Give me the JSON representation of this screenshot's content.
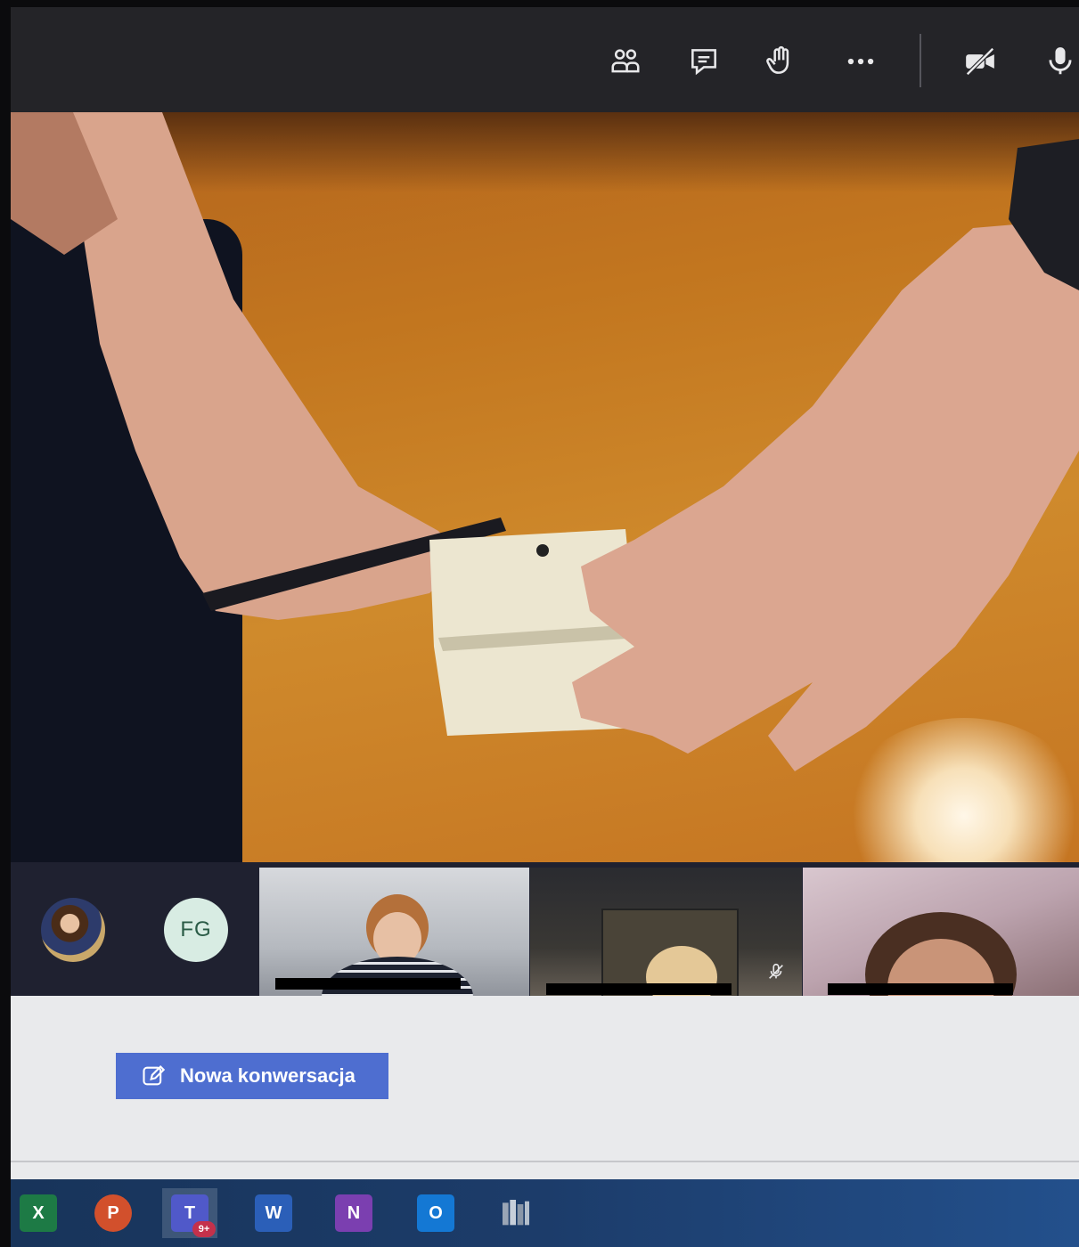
{
  "meeting_toolbar": {
    "buttons": [
      {
        "name": "show-participants",
        "icon": "people-icon"
      },
      {
        "name": "show-conversation",
        "icon": "chat-icon"
      },
      {
        "name": "raise-hand",
        "icon": "hand-icon"
      },
      {
        "name": "more-actions",
        "icon": "more-icon"
      },
      {
        "name": "camera",
        "icon": "camera-off-icon"
      },
      {
        "name": "microphone",
        "icon": "microphone-icon"
      }
    ]
  },
  "participants": {
    "initials_avatar": "FG",
    "tiles": [
      {
        "name": "participant-1",
        "muted": false
      },
      {
        "name": "participant-2",
        "muted": true
      },
      {
        "name": "participant-3",
        "muted": false
      }
    ]
  },
  "chat_panel": {
    "new_conversation_label": "Nowa konwersacja",
    "new_conversation_icon": "compose-icon"
  },
  "taskbar": {
    "apps": [
      {
        "letter": "X",
        "name": "excel",
        "color": "#1d7a45"
      },
      {
        "letter": "P",
        "name": "powerpoint",
        "color": "#d2502c"
      },
      {
        "letter": "T",
        "name": "teams",
        "color": "#5059c9",
        "badge": "9+",
        "active": true
      },
      {
        "letter": "W",
        "name": "word",
        "color": "#2b5fb8"
      },
      {
        "letter": "N",
        "name": "onenote",
        "color": "#7b3fb0"
      },
      {
        "letter": "O",
        "name": "outlook",
        "color": "#1478d4"
      },
      {
        "letter": "",
        "name": "library",
        "color": "#8a97a8"
      }
    ]
  },
  "colors": {
    "toolbar_bg": "#242428",
    "accent": "#4e6ed0",
    "taskbar": "#1c3c6a"
  }
}
